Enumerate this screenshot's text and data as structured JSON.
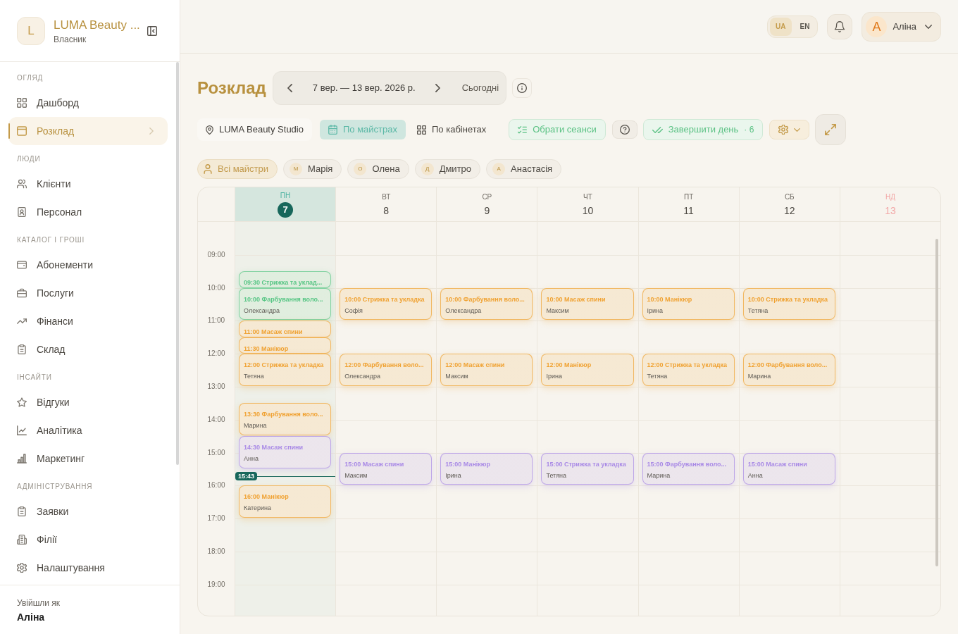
{
  "sidebar": {
    "brand": {
      "initial": "L",
      "name": "LUMA Beauty ...",
      "role": "Власник"
    },
    "sections": [
      {
        "heading": "ОГЛЯД",
        "items": [
          {
            "label": "Дашборд",
            "selected": false
          },
          {
            "label": "Розклад",
            "selected": true
          }
        ]
      },
      {
        "heading": "ЛЮДИ",
        "items": [
          {
            "label": "Клієнти",
            "selected": false
          },
          {
            "label": "Персонал",
            "selected": false
          }
        ]
      },
      {
        "heading": "КАТАЛОГ І ГРОШІ",
        "items": [
          {
            "label": "Абонементи",
            "selected": false
          },
          {
            "label": "Послуги",
            "selected": false
          },
          {
            "label": "Фінанси",
            "selected": false
          },
          {
            "label": "Склад",
            "selected": false
          }
        ]
      },
      {
        "heading": "ІНСАЙТИ",
        "items": [
          {
            "label": "Відгуки",
            "selected": false
          },
          {
            "label": "Аналітика",
            "selected": false
          },
          {
            "label": "Маркетинг",
            "selected": false
          }
        ]
      },
      {
        "heading": "АДМІНІСТРУВАННЯ",
        "items": [
          {
            "label": "Заявки",
            "selected": false
          },
          {
            "label": "Філії",
            "selected": false
          },
          {
            "label": "Налаштування",
            "selected": false
          }
        ]
      }
    ],
    "footer": {
      "caption": "Увійшли як",
      "user": "Аліна"
    }
  },
  "topbar": {
    "languages": [
      {
        "label": "UA",
        "selected": true
      },
      {
        "label": "EN",
        "selected": false
      }
    ],
    "user": {
      "initial": "А",
      "name": "Аліна"
    }
  },
  "page": {
    "title": "Розклад",
    "date_range": "7 вер. — 13 вер. 2026 р.",
    "today_button": "Сьогодні"
  },
  "toolbar": {
    "location": "LUMA Beauty Studio",
    "views": [
      {
        "label": "По майстрах",
        "selected": true
      },
      {
        "label": "По кабінетах",
        "selected": false
      }
    ],
    "select_button": "Обрати сеанси",
    "finish_button": {
      "label": "Завершити день",
      "count": "· 6"
    }
  },
  "filters": [
    {
      "kind": "all",
      "label": "Всі майстри",
      "selected": true
    },
    {
      "kind": "master",
      "initial": "М",
      "label": "Марія",
      "selected": false
    },
    {
      "kind": "master",
      "initial": "О",
      "label": "Олена",
      "selected": false
    },
    {
      "kind": "master",
      "initial": "Д",
      "label": "Дмитро",
      "selected": false
    },
    {
      "kind": "master",
      "initial": "А",
      "label": "Анастасія",
      "selected": false
    }
  ],
  "calendar": {
    "hours": [
      "09:00",
      "10:00",
      "11:00",
      "12:00",
      "13:00",
      "14:00",
      "15:00",
      "16:00",
      "17:00",
      "18:00",
      "19:00"
    ],
    "now": "15:43",
    "days": [
      {
        "weekday": "ПН",
        "date": "7",
        "kind": "today",
        "events": [
          {
            "time": "09:30",
            "title": "Стрижка та уклад...",
            "color": "#58c685"
          },
          {
            "time": "10:00",
            "title": "Фарбування воло...",
            "client": "Олександра",
            "color": "#58c685"
          },
          {
            "time": "11:00",
            "title": "Масаж спини",
            "color": "#f0a232"
          },
          {
            "time": "11:30",
            "title": "Манікюр",
            "color": "#f0a232"
          },
          {
            "time": "12:00",
            "title": "Стрижка та укладка",
            "client": "Тетяна",
            "color": "#f0a232"
          },
          {
            "time": "13:30",
            "title": "Фарбування воло...",
            "client": "Марина",
            "color": "#f0a232"
          },
          {
            "time": "14:30",
            "title": "Масаж спини",
            "client": "Анна",
            "color": "#a98ae6"
          },
          {
            "time": "16:00",
            "title": "Манікюр",
            "client": "Катерина",
            "color": "#f0a232"
          }
        ]
      },
      {
        "weekday": "ВТ",
        "date": "8",
        "kind": "workday",
        "events": [
          {
            "time": "10:00",
            "title": "Стрижка та укладка",
            "client": "Софія",
            "color": "#f0a232"
          },
          {
            "time": "12:00",
            "title": "Фарбування воло...",
            "client": "Олександра",
            "color": "#f0a232"
          },
          {
            "time": "15:00",
            "title": "Масаж спини",
            "client": "Максим",
            "color": "#a98ae6"
          }
        ]
      },
      {
        "weekday": "СР",
        "date": "9",
        "kind": "workday",
        "events": [
          {
            "time": "10:00",
            "title": "Фарбування воло...",
            "client": "Олександра",
            "color": "#f0a232"
          },
          {
            "time": "12:00",
            "title": "Масаж спини",
            "client": "Максим",
            "color": "#f0a232"
          },
          {
            "time": "15:00",
            "title": "Манікюр",
            "client": "Ірина",
            "color": "#a98ae6"
          }
        ]
      },
      {
        "weekday": "ЧТ",
        "date": "10",
        "kind": "workday",
        "events": [
          {
            "time": "10:00",
            "title": "Масаж спини",
            "client": "Максим",
            "color": "#f0a232"
          },
          {
            "time": "12:00",
            "title": "Манікюр",
            "client": "Ірина",
            "color": "#f0a232"
          },
          {
            "time": "15:00",
            "title": "Стрижка та укладка",
            "client": "Тетяна",
            "color": "#a98ae6"
          }
        ]
      },
      {
        "weekday": "ПТ",
        "date": "11",
        "kind": "workday",
        "events": [
          {
            "time": "10:00",
            "title": "Манікюр",
            "client": "Ірина",
            "color": "#f0a232"
          },
          {
            "time": "12:00",
            "title": "Стрижка та укладка",
            "client": "Тетяна",
            "color": "#f0a232"
          },
          {
            "time": "15:00",
            "title": "Фарбування воло...",
            "client": "Марина",
            "color": "#a98ae6"
          }
        ]
      },
      {
        "weekday": "СБ",
        "date": "12",
        "kind": "workday",
        "events": [
          {
            "time": "10:00",
            "title": "Стрижка та укладка",
            "client": "Тетяна",
            "color": "#f0a232"
          },
          {
            "time": "12:00",
            "title": "Фарбування воло...",
            "client": "Марина",
            "color": "#f0a232"
          },
          {
            "time": "15:00",
            "title": "Масаж спини",
            "client": "Анна",
            "color": "#a98ae6"
          }
        ]
      },
      {
        "weekday": "НД",
        "date": "13",
        "kind": "dayoff"
      }
    ]
  }
}
